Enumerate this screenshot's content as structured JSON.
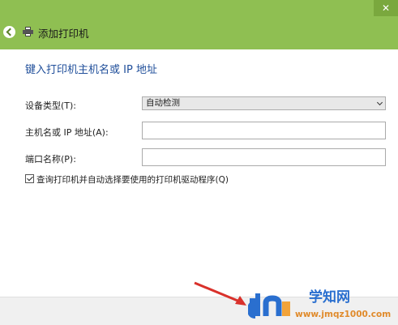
{
  "window": {
    "title": "添加打印机"
  },
  "main": {
    "heading": "键入打印机主机名或 IP 地址",
    "device_type": {
      "label": "设备类型(T):",
      "value": "自动检测"
    },
    "hostname": {
      "label": "主机名或 IP 地址(A):",
      "value": ""
    },
    "port_name": {
      "label": "端口名称(P):",
      "value": ""
    },
    "query_printer": {
      "label": "查询打印机并自动选择要使用的打印机驱动程序(Q)",
      "checked": true
    }
  },
  "watermark": {
    "site_name": "学知网",
    "url": "www.jmqz1000.com"
  },
  "colors": {
    "titlebar": "#8fbf52",
    "heading": "#1f4e9a",
    "arrow": "#d9312b"
  }
}
